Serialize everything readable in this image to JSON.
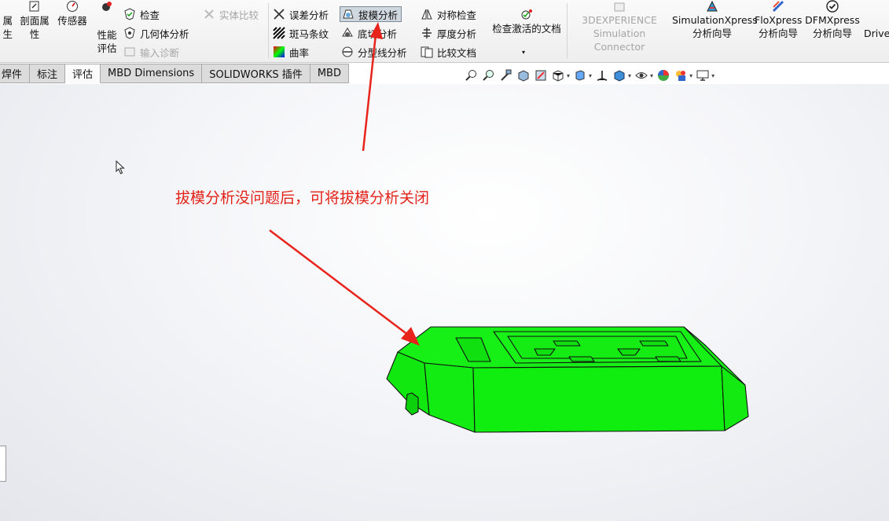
{
  "ribbon": {
    "left_cut_line1": "属",
    "left_cut_line2": "生",
    "section_props": {
      "line1": "剖面属",
      "line2": "性"
    },
    "sensor": "传感器",
    "performance": {
      "line1": "性能",
      "line2": "评估"
    },
    "check": "检查",
    "geometry_analysis": "几何体分析",
    "import_diagnosis": "输入诊断",
    "compare_entities": "实体比较",
    "deviation_analysis": "误差分析",
    "zebra_stripes": "斑马条纹",
    "curvature": "曲率",
    "draft_analysis": "拔模分析",
    "undercut_analysis": "底切分析",
    "parting_line_analysis": "分型线分析",
    "symmetry_check": "对称检查",
    "thickness_analysis": "厚度分析",
    "compare_documents": "比较文档",
    "check_active_doc": "检查激活的文档",
    "experience_connector": {
      "line1": "3DEXPERIENCE",
      "line2": "Simulation Connector"
    },
    "simulation_xpress": {
      "line1": "SimulationXpress",
      "line2": "分析向导"
    },
    "flo_xpress": {
      "line1": "FloXpress",
      "line2": "分析向导"
    },
    "dfm_xpress": {
      "line1": "DFMXpress",
      "line2": "分析向导"
    },
    "drive_works": "DriveW"
  },
  "tabs": [
    "焊件",
    "标注",
    "评估",
    "MBD Dimensions",
    "SOLIDWORKS 插件",
    "MBD"
  ],
  "active_tab": "评估",
  "annotation": "拔模分析没问题后，可将拔模分析关闭",
  "colors": {
    "accent_red": "#e8231b",
    "model_green": "#11ee11",
    "active_button": "#cfd7df"
  }
}
